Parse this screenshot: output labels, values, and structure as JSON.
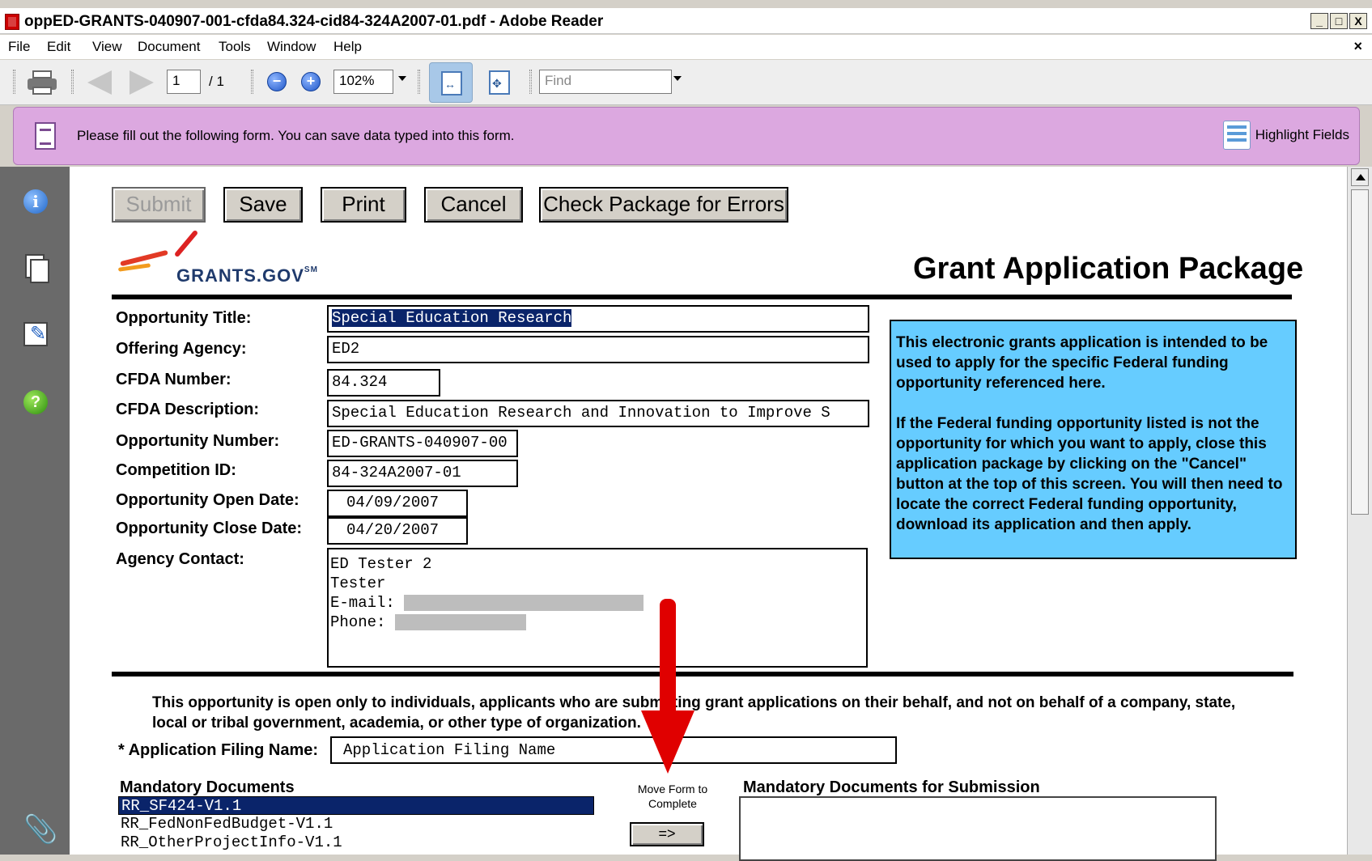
{
  "window": {
    "title": "oppED-GRANTS-040907-001-cfda84.324-cid84-324A2007-01.pdf - Adobe Reader",
    "controls": [
      "_",
      "□",
      "X"
    ]
  },
  "menu": {
    "items": [
      "File",
      "Edit",
      "View",
      "Document",
      "Tools",
      "Window",
      "Help"
    ],
    "close": "×"
  },
  "toolbar": {
    "page_current": "1",
    "page_total": "/ 1",
    "zoom": "102%",
    "find_placeholder": "Find",
    "zoom_out": "−",
    "zoom_in": "+"
  },
  "banner": {
    "message": "Please fill out the following form. You can save data typed into this form.",
    "highlight_label": "Highlight Fields"
  },
  "nav": {
    "info_glyph": "i",
    "help_glyph": "?",
    "clip_glyph": "⌀"
  },
  "form": {
    "buttons": {
      "submit": "Submit",
      "save": "Save",
      "print": "Print",
      "cancel": "Cancel",
      "check": "Check Package for Errors"
    },
    "logo": {
      "text": "GRANTS.GOV",
      "mark": "SM"
    },
    "package_title": "Grant Application Package",
    "labels": {
      "opportunity_title": "Opportunity Title:",
      "offering_agency": "Offering Agency:",
      "cfda_number": "CFDA Number:",
      "cfda_description": "CFDA Description:",
      "opportunity_number": "Opportunity Number:",
      "competition_id": "Competition ID:",
      "open_date": "Opportunity Open Date:",
      "close_date": "Opportunity Close Date:",
      "agency_contact": "Agency Contact:"
    },
    "values": {
      "opportunity_title": "Special Education Research",
      "offering_agency": "ED2",
      "cfda_number": "84.324",
      "cfda_description": "Special Education Research and Innovation to Improve S",
      "opportunity_number": "ED-GRANTS-040907-00",
      "competition_id": "84-324A2007-01",
      "open_date": "04/09/2007",
      "close_date": "04/20/2007"
    },
    "contact": {
      "name": "ED Tester 2",
      "role": "Tester",
      "email_label": "E-mail: ",
      "phone_label": "Phone: "
    },
    "info_box": {
      "para1": "This electronic grants application is intended to be used to apply for the specific Federal funding opportunity referenced here.",
      "para2": "If the Federal funding opportunity listed is not the opportunity for which you want to apply, close this application package by clicking on the \"Cancel\" button at the top of this screen. You will  then need to locate the correct Federal funding opportunity, download its application and then apply."
    },
    "notice": "This opportunity is open only to individuals, applicants who are submitting grant applications on their behalf, and not on behalf of a company, state, local or tribal government, academia, or other type of organization.",
    "filing_name_label": "* Application Filing Name:",
    "filing_name_value": "Application Filing Name",
    "mandatory_docs_label": "Mandatory Documents",
    "mandatory_docs": [
      "RR_SF424-V1.1",
      "RR_FedNonFedBudget-V1.1",
      "RR_OtherProjectInfo-V1.1"
    ],
    "move_label": "Move Form to Complete",
    "move_button": "=>",
    "submission_docs_label": "Mandatory Documents for Submission"
  }
}
